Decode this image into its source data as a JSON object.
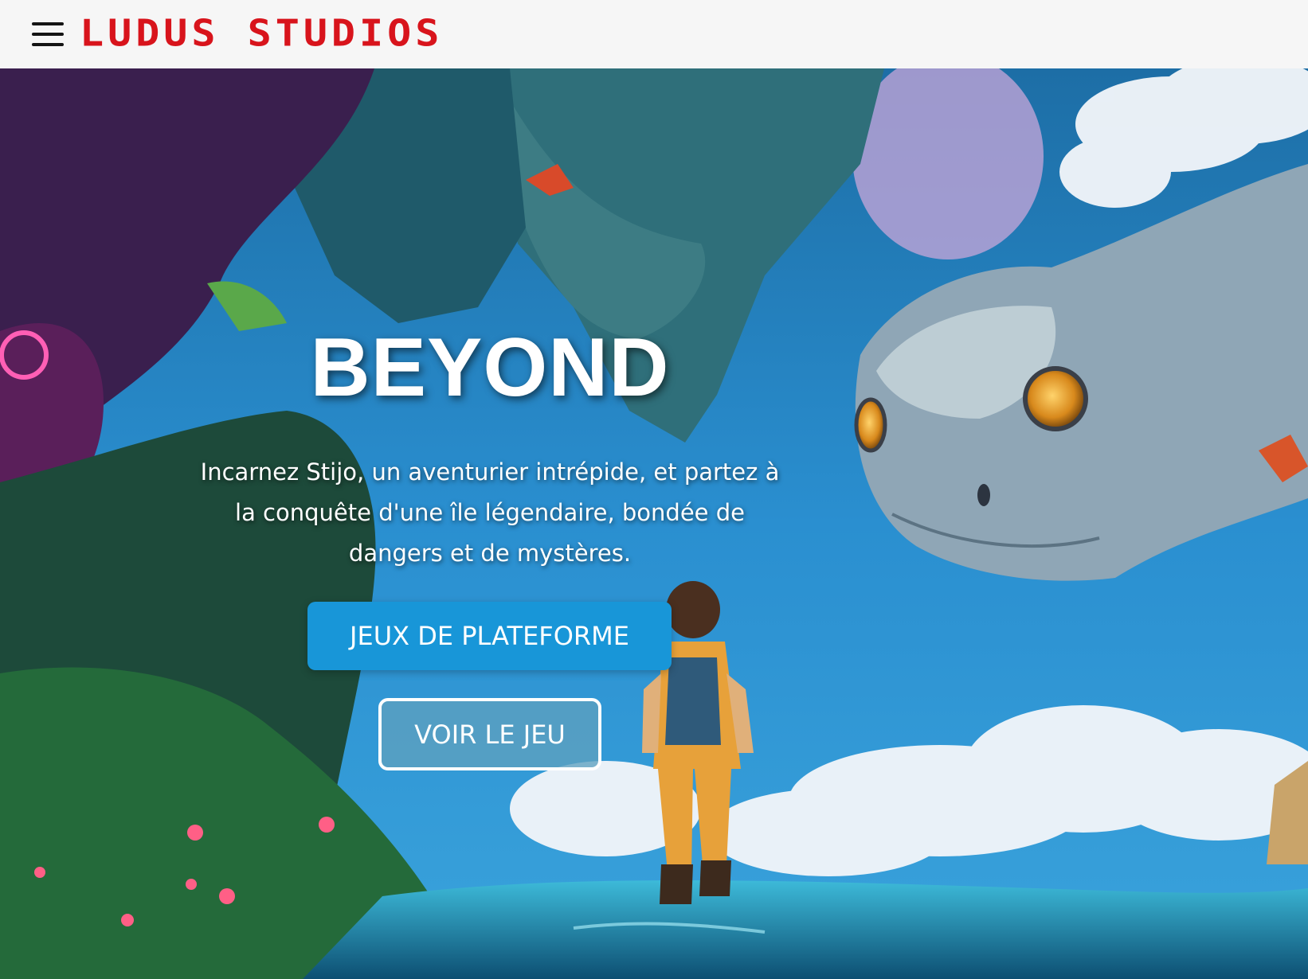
{
  "header": {
    "logo_text": "LUDUS STUDIOS",
    "menu_icon": "hamburger-menu-icon",
    "logo_color": "#d8141c",
    "background": "#f6f6f6"
  },
  "hero": {
    "title": "BEYOND",
    "description": "Incarnez Stijo, un aventurier intrépide, et partez à la conquête d'une île légendaire, bondée de dangers et de mystères.",
    "primary_button_label": "JEUX DE PLATEFORME",
    "secondary_button_label": "VOIR LE JEU",
    "primary_button_color": "#1896d8"
  }
}
